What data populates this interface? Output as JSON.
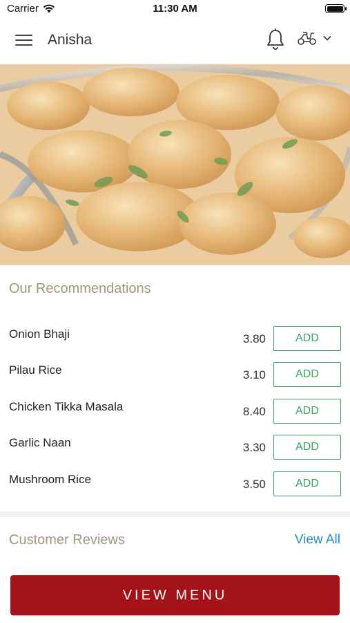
{
  "status_bar": {
    "carrier": "Carrier",
    "time": "11:30 AM",
    "icons": [
      "wifi-icon",
      "battery-icon"
    ]
  },
  "header": {
    "title": "Anisha",
    "icons": [
      "hamburger-menu-icon",
      "bell-icon",
      "scooter-icon",
      "chevron-down-icon"
    ]
  },
  "hero": {
    "image": "chicken-curry-dish"
  },
  "recommendations": {
    "title": "Our Recommendations",
    "items": [
      {
        "name": "Onion Bhaji",
        "price": "3.80",
        "button": "ADD"
      },
      {
        "name": "Pilau Rice",
        "price": "3.10",
        "button": "ADD"
      },
      {
        "name": "Chicken Tikka Masala",
        "price": "8.40",
        "button": "ADD"
      },
      {
        "name": "Garlic Naan",
        "price": "3.30",
        "button": "ADD"
      },
      {
        "name": "Mushroom Rice",
        "price": "3.50",
        "button": "ADD"
      }
    ]
  },
  "reviews": {
    "title": "Customer Reviews",
    "view_all": "View All"
  },
  "footer": {
    "button": "VIEW MENU"
  },
  "colors": {
    "accent_red": "#a4121a",
    "add_green": "#3aa35d",
    "link_blue": "#2a8fc7",
    "section_title": "#a3967c"
  }
}
